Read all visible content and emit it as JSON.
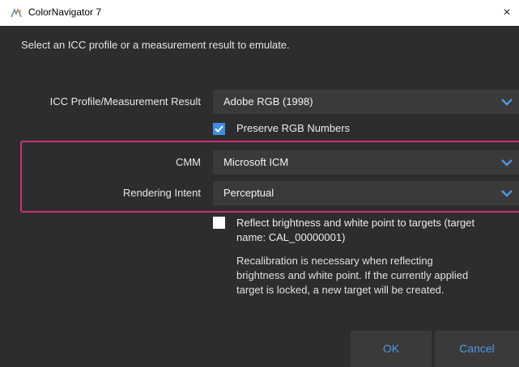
{
  "window": {
    "title": "ColorNavigator 7",
    "close_glyph": "×"
  },
  "dialog": {
    "instruction": "Select an ICC profile or a measurement result to emulate."
  },
  "icc_profile": {
    "label": "ICC Profile/Measurement Result",
    "value": "Adobe RGB (1998)"
  },
  "preserve_rgb": {
    "label": "Preserve RGB Numbers",
    "checked": true
  },
  "cmm": {
    "label": "CMM",
    "value": "Microsoft ICM"
  },
  "rendering_intent": {
    "label": "Rendering Intent",
    "value": "Perceptual"
  },
  "reflect": {
    "label_line1": "Reflect brightness and white point to targets (target",
    "label_line2": "name: CAL_00000001)",
    "checked": false,
    "note_line1": "Recalibration is necessary when reflecting",
    "note_line2": "brightness and white point. If the currently applied",
    "note_line3": "target is locked, a new target will be created."
  },
  "buttons": {
    "ok": "OK",
    "cancel": "Cancel"
  },
  "colors": {
    "accent": "#4f98e6",
    "highlight_border": "#c8307d",
    "background": "#2d2d2d",
    "control": "#3a3a3a"
  },
  "icons": {
    "app": "colornavigator-icon",
    "dropdown": "chevron-down-icon",
    "check": "checkmark-icon"
  }
}
